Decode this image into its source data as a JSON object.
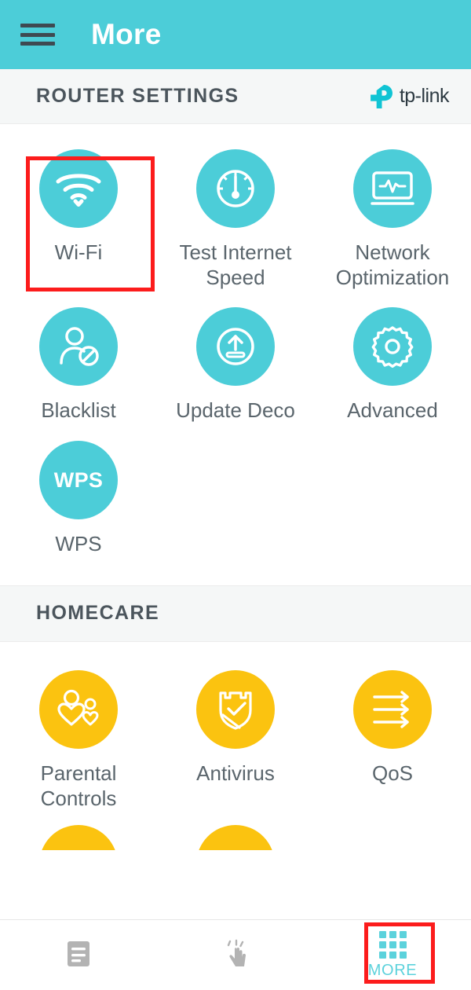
{
  "appbar": {
    "title": "More",
    "menu_icon": "hamburger-menu-icon",
    "background_color": "#4ccdd8"
  },
  "router_settings": {
    "section_title": "ROUTER SETTINGS",
    "brand_logo_text": "tp-link",
    "brand_color": "#4ccdd8",
    "tiles": [
      {
        "label": "Wi-Fi",
        "icon": "wifi-icon",
        "color": "#4ccdd8",
        "highlighted": true
      },
      {
        "label": "Test Internet Speed",
        "icon": "speedometer-icon",
        "color": "#4ccdd8",
        "highlighted": false
      },
      {
        "label": "Network Optimization",
        "icon": "monitor-pulse-icon",
        "color": "#4ccdd8",
        "highlighted": false
      },
      {
        "label": "Blacklist",
        "icon": "user-blocked-icon",
        "color": "#4ccdd8",
        "highlighted": false
      },
      {
        "label": "Update Deco",
        "icon": "upload-circle-icon",
        "color": "#4ccdd8",
        "highlighted": false
      },
      {
        "label": "Advanced",
        "icon": "gear-icon",
        "color": "#4ccdd8",
        "highlighted": false
      },
      {
        "label": "WPS",
        "icon": "wps-text-icon",
        "color": "#4ccdd8",
        "highlighted": false
      }
    ]
  },
  "homecare": {
    "section_title": "HOMECARE",
    "tiles": [
      {
        "label": "Parental Controls",
        "icon": "parent-child-hearts-icon",
        "color": "#fbc310"
      },
      {
        "label": "Antivirus",
        "icon": "shield-check-icon",
        "color": "#fbc310"
      },
      {
        "label": "QoS",
        "icon": "three-arrows-icon",
        "color": "#fbc310"
      }
    ]
  },
  "bottom_nav": {
    "items": [
      {
        "label": "",
        "icon": "document-list-icon",
        "active": false,
        "highlighted": false
      },
      {
        "label": "",
        "icon": "tap-hand-icon",
        "active": false,
        "highlighted": false
      },
      {
        "label": "MORE",
        "icon": "grid-apps-icon",
        "active": true,
        "highlighted": true
      }
    ],
    "active_color": "#5cd2dc",
    "inactive_color": "#b3b3b3"
  },
  "annotation": {
    "highlight_color": "#fc1c1c",
    "boxes": [
      "wifi-tile",
      "more-nav-item"
    ]
  }
}
